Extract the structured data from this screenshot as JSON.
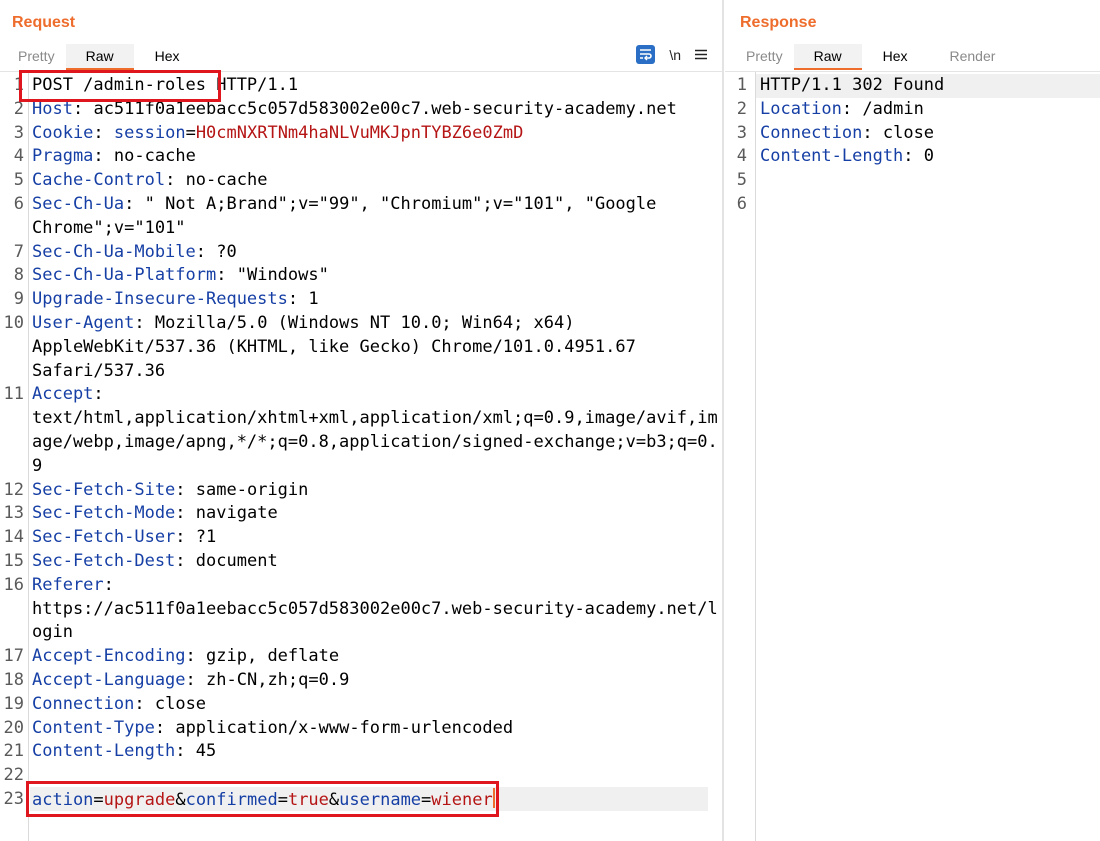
{
  "request": {
    "title": "Request",
    "tabs": [
      "Pretty",
      "Raw",
      "Hex"
    ],
    "active_tab": "Raw",
    "toolbar": {
      "wrap_icon": "word-wrap-icon",
      "newline_label": "\\n",
      "menu_icon": "hamburger-menu-icon"
    },
    "lines": [
      [
        "1",
        "POST /admin-roles HTTP/1.1"
      ],
      [
        "2",
        "Host",
        "ac511f0a1eebacc5c057d583002e00c7.web-security-academy.net"
      ],
      [
        "3",
        "Cookie",
        "session",
        "H0cmNXRTNm4haNLVuMKJpnTYBZ6e0ZmD"
      ],
      [
        "4",
        "Pragma",
        "no-cache"
      ],
      [
        "5",
        "Cache-Control",
        "no-cache"
      ],
      [
        "6",
        "Sec-Ch-Ua",
        "\" Not A;Brand\";v=\"99\", \"Chromium\";v=\"101\", \"Google",
        "Chrome\";v=\"101\""
      ],
      [
        "7",
        "Sec-Ch-Ua-Mobile",
        "?0"
      ],
      [
        "8",
        "Sec-Ch-Ua-Platform",
        "\"Windows\""
      ],
      [
        "9",
        "Upgrade-Insecure-Requests",
        "1"
      ],
      [
        "10",
        "User-Agent",
        "Mozilla/5.0 (Windows NT 10.0; Win64; x64)",
        "AppleWebKit/537.36 (KHTML, like Gecko) Chrome/101.0.4951.67",
        "Safari/537.36"
      ],
      [
        "11",
        "Accept",
        "",
        "text/html,application/xhtml+xml,application/xml;q=0.9,image/avif,im",
        "age/webp,image/apng,*/*;q=0.8,application/signed-exchange;v=b3;q=0.",
        "9"
      ],
      [
        "12",
        "Sec-Fetch-Site",
        "same-origin"
      ],
      [
        "13",
        "Sec-Fetch-Mode",
        "navigate"
      ],
      [
        "14",
        "Sec-Fetch-User",
        "?1"
      ],
      [
        "15",
        "Sec-Fetch-Dest",
        "document"
      ],
      [
        "16",
        "Referer",
        "",
        "https://ac511f0a1eebacc5c057d583002e00c7.web-security-academy.net/l",
        "ogin"
      ],
      [
        "17",
        "Accept-Encoding",
        "gzip, deflate"
      ],
      [
        "18",
        "Accept-Language",
        "zh-CN,zh;q=0.9"
      ],
      [
        "19",
        "Connection",
        "close"
      ],
      [
        "20",
        "Content-Type",
        "application/x-www-form-urlencoded"
      ],
      [
        "21",
        "Content-Length",
        "45"
      ],
      [
        "22",
        ""
      ],
      [
        "23",
        "action",
        "upgrade",
        "confirmed",
        "true",
        "username",
        "wiener"
      ]
    ]
  },
  "response": {
    "title": "Response",
    "tabs": [
      "Pretty",
      "Raw",
      "Hex",
      "Render"
    ],
    "active_tab": "Raw",
    "lines": [
      [
        "1",
        "HTTP/1.1 302 Found"
      ],
      [
        "2",
        "Location",
        "/admin"
      ],
      [
        "3",
        "Connection",
        "close"
      ],
      [
        "4",
        "Content-Length",
        "0"
      ],
      [
        "5",
        ""
      ],
      [
        "6",
        ""
      ]
    ]
  },
  "colors": {
    "accent": "#ee6d2d",
    "header_name": "#163fa5",
    "cookie_value": "#b51515",
    "highlight_box": "#e0161e",
    "wrap_icon_bg": "#2a6fc5"
  }
}
